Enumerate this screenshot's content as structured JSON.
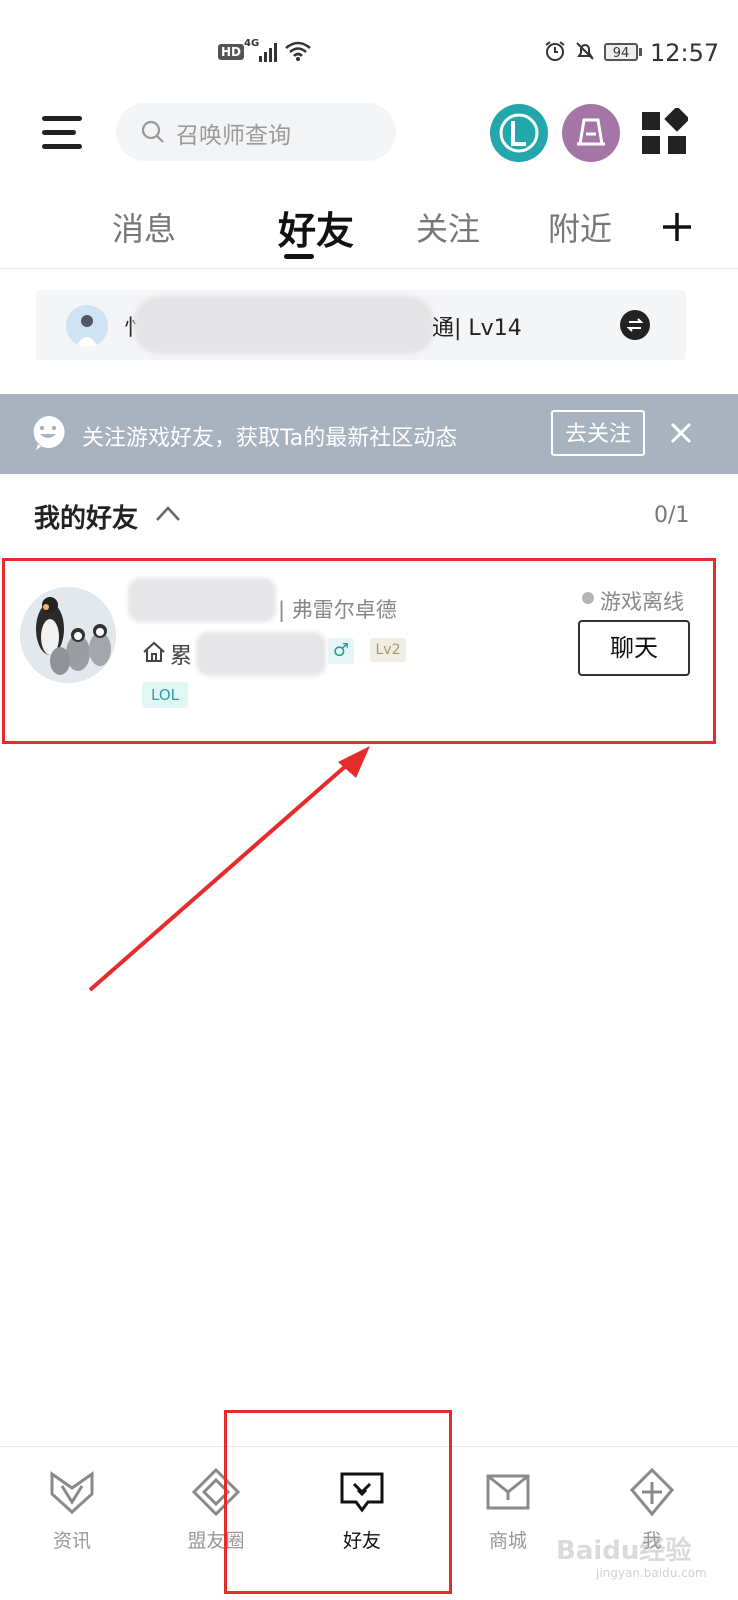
{
  "status_bar": {
    "hd": "HD",
    "network": "4G",
    "battery": "94",
    "time": "12:57"
  },
  "header": {
    "search_placeholder": "召唤师查询"
  },
  "tabs": [
    {
      "label": "消息",
      "active": false
    },
    {
      "label": "好友",
      "active": true
    },
    {
      "label": "关注",
      "active": false
    },
    {
      "label": "附近",
      "active": false
    }
  ],
  "account": {
    "name_prefix": "忄",
    "name_suffix": "通",
    "level": "| Lv14"
  },
  "banner": {
    "text": "关注游戏好友，获取Ta的最新社区动态",
    "button": "去关注"
  },
  "friends_section": {
    "title": "我的好友",
    "count": "0/1"
  },
  "friend": {
    "server": "| 弗雷尔卓德",
    "home_prefix": "累",
    "gender": "♂",
    "level": "Lv2",
    "tag": "LOL",
    "status": "游戏离线",
    "chat_button": "聊天"
  },
  "bottom_nav": [
    {
      "label": "资讯",
      "icon": "news-icon"
    },
    {
      "label": "盟友圈",
      "icon": "ally-circle-icon"
    },
    {
      "label": "好友",
      "icon": "friends-icon",
      "active": true
    },
    {
      "label": "商城",
      "icon": "shop-icon"
    },
    {
      "label": "我",
      "icon": "profile-icon"
    }
  ],
  "watermark": {
    "brand": "Baidu经验",
    "url": "jingyan.baidu.com"
  },
  "colors": {
    "accent_teal": "#23a6ac",
    "highlight_red": "#e52b2b",
    "banner_gray": "#a9b2bf"
  }
}
